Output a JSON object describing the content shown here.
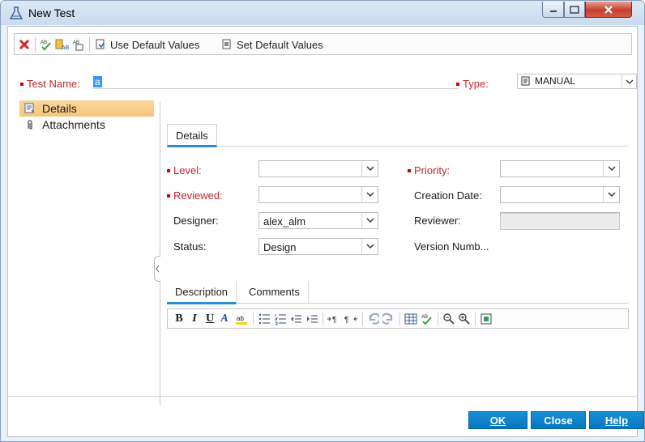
{
  "window": {
    "title": "New Test"
  },
  "toolbar": {
    "icons": [
      "delete-icon",
      "spellcheck-icon",
      "thesaurus-icon",
      "spelling-options-icon",
      "use-defaults-icon",
      "set-defaults-icon"
    ],
    "use_default_label": "Use Default Values",
    "set_default_label": "Set Default Values"
  },
  "header": {
    "test_name_label": "Test Name:",
    "test_name_value": "a",
    "type_label": "Type:",
    "type_value": "MANUAL"
  },
  "sidebar": {
    "items": [
      {
        "label": "Details"
      },
      {
        "label": "Attachments"
      }
    ]
  },
  "details_tab": {
    "label": "Details"
  },
  "fields": {
    "level": {
      "label": "Level:",
      "value": ""
    },
    "reviewed": {
      "label": "Reviewed:",
      "value": ""
    },
    "designer": {
      "label": "Designer:",
      "value": "alex_alm"
    },
    "status": {
      "label": "Status:",
      "value": "Design"
    },
    "priority": {
      "label": "Priority:",
      "value": ""
    },
    "creation_date": {
      "label": "Creation Date:",
      "value": ""
    },
    "reviewer": {
      "label": "Reviewer:",
      "value": ""
    },
    "version": {
      "label": "Version Numb...",
      "value": ""
    }
  },
  "desc_tabs": [
    {
      "label": "Description"
    },
    {
      "label": "Comments"
    }
  ],
  "rich_toolbar": {
    "bold": "B",
    "italic": "I",
    "underline": "U",
    "font": "A"
  },
  "buttons": {
    "ok": "OK",
    "close": "Close",
    "help": "Help"
  },
  "colors": {
    "accent": "#0677c0",
    "selected": "#f7c47a",
    "required": "#c0272d"
  }
}
